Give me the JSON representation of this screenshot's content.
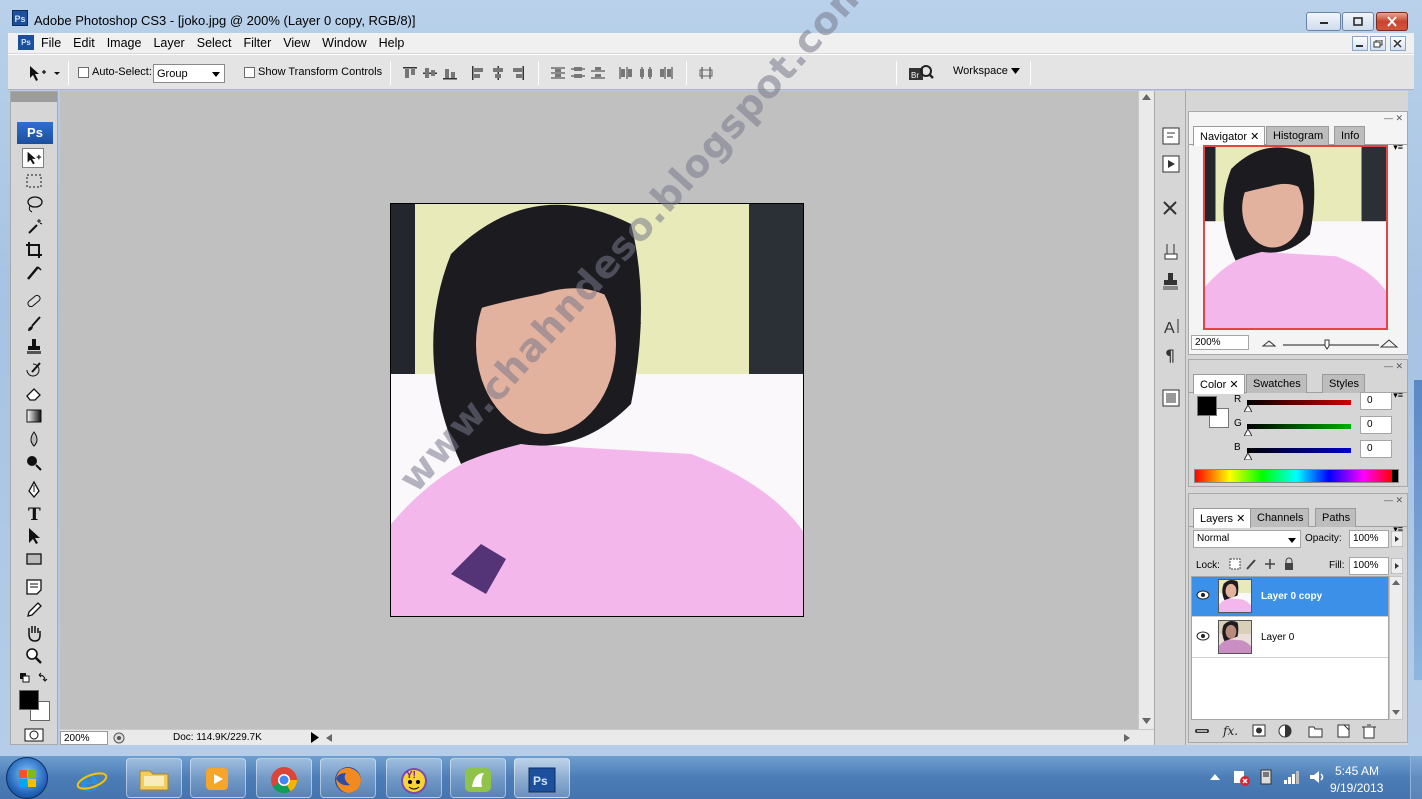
{
  "window": {
    "title": "Adobe Photoshop CS3 - [joko.jpg @ 200% (Layer 0 copy, RGB/8)]",
    "app_icon": "Ps"
  },
  "menu": {
    "items": [
      "File",
      "Edit",
      "Image",
      "Layer",
      "Select",
      "Filter",
      "View",
      "Window",
      "Help"
    ]
  },
  "options": {
    "auto_select_label": "Auto-Select:",
    "auto_select_value": "Group",
    "show_transform_label": "Show Transform Controls",
    "workspace_label": "Workspace"
  },
  "toolbox": {
    "logo": "Ps",
    "tools": [
      "move-tool-icon",
      "marquee-tool-icon",
      "lasso-tool-icon",
      "magic-wand-icon",
      "crop-tool-icon",
      "slice-tool-icon",
      "healing-brush-icon",
      "brush-tool-icon",
      "clone-stamp-icon",
      "history-brush-icon",
      "eraser-icon",
      "gradient-icon",
      "blur-icon",
      "dodge-icon",
      "pen-tool-icon",
      "type-tool-icon",
      "path-select-icon",
      "shape-tool-icon",
      "notes-icon",
      "eyedropper-icon",
      "hand-tool-icon",
      "zoom-tool-icon"
    ]
  },
  "canvas": {
    "watermark": "www.chahndeso.blogspot.com",
    "photo_alt": "joko.jpg",
    "background": "#c0c0c0"
  },
  "status": {
    "zoom": "200%",
    "doc_info": "Doc: 114.9K/229.7K"
  },
  "navigator_panel": {
    "tabs": [
      "Navigator",
      "Histogram",
      "Info"
    ],
    "zoom": "200%"
  },
  "color_panel": {
    "tabs": [
      "Color",
      "Swatches",
      "Styles"
    ],
    "channels": [
      {
        "label": "R",
        "value": "0",
        "color": "#d00000"
      },
      {
        "label": "G",
        "value": "0",
        "color": "#00b000"
      },
      {
        "label": "B",
        "value": "0",
        "color": "#0000d0"
      }
    ]
  },
  "layers_panel": {
    "tabs": [
      "Layers",
      "Channels",
      "Paths"
    ],
    "blend_mode": "Normal",
    "opacity_label": "Opacity:",
    "opacity": "100%",
    "lock_label": "Lock:",
    "fill_label": "Fill:",
    "fill": "100%",
    "layers": [
      {
        "name": "Layer 0 copy",
        "selected": true
      },
      {
        "name": "Layer 0",
        "selected": false
      }
    ]
  },
  "taskbar": {
    "apps": [
      "internet-explorer-icon",
      "file-explorer-icon",
      "media-player-icon",
      "chrome-icon",
      "firefox-icon",
      "yahoo-messenger-icon",
      "app-icon",
      "photoshop-icon"
    ],
    "photoshop_label": "Ps",
    "time": "5:45 AM",
    "date": "9/19/2013"
  },
  "colors": {
    "selection": "#3d90e8",
    "panel_bg": "#d6d6d6",
    "navigator_frame": "#e24545"
  }
}
